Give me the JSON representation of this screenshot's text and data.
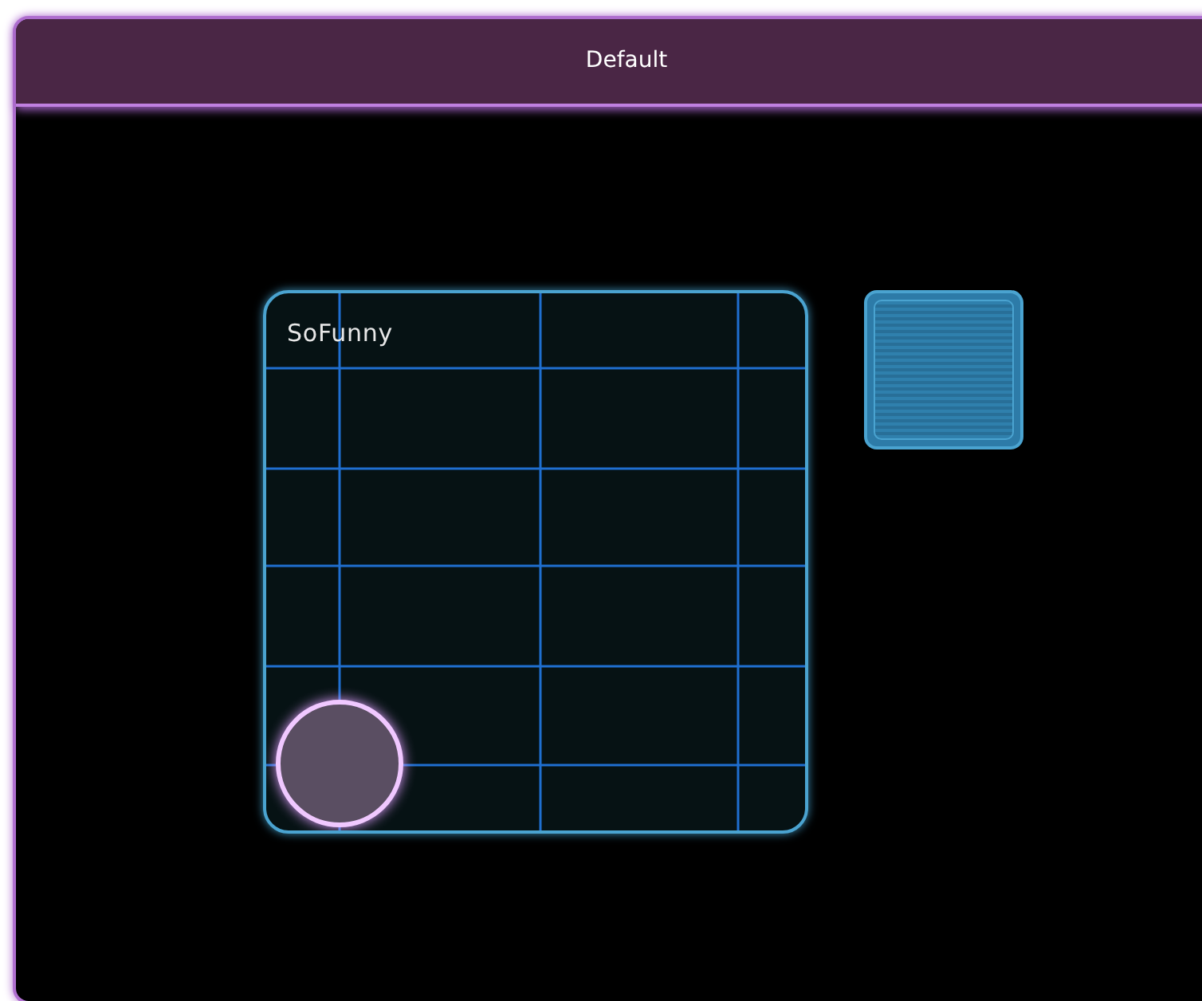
{
  "window": {
    "title": "Default"
  },
  "xy_pad": {
    "label": "SoFunny",
    "x_handle": {
      "level": 0.135
    },
    "y_handle": {
      "level": 0.135
    }
  },
  "toggle": {
    "on": true
  }
}
